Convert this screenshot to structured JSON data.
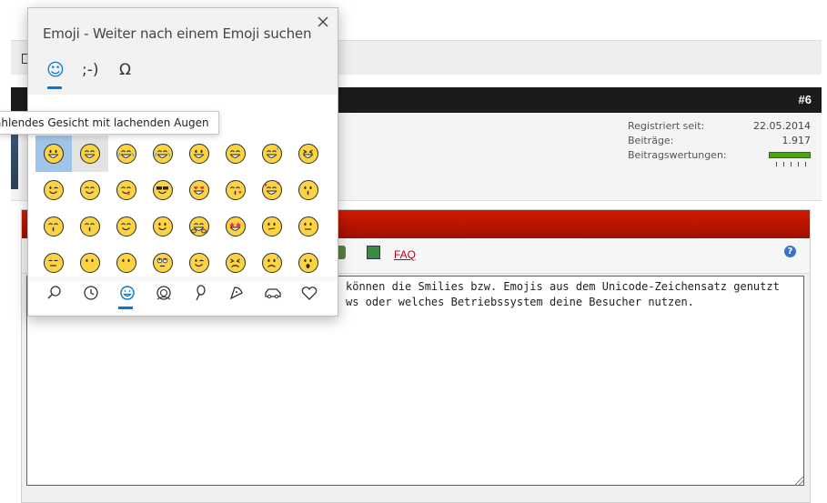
{
  "forum": {
    "post_number": "#6",
    "user_info": {
      "registered_label": "Registriert seit:",
      "registered_value": "22.05.2014",
      "posts_label": "Beiträge:",
      "posts_value": "1.917",
      "ratings_label": "Beitragswertungen:"
    },
    "toolbar": {
      "faq_label": "FAQ",
      "help_label": "?"
    },
    "textarea_line1": "können die Smilies bzw. Emojis aus dem Unicode-Zeichensatz genutzt",
    "textarea_line2": "ws oder welches Betriebssystem deine Besucher nutzen."
  },
  "emoji_panel": {
    "title": "Emoji - Weiter nach einem Emoji suchen",
    "close_icon": "close-icon",
    "tabs": [
      {
        "label": "☺",
        "name": "emoji-tab",
        "selected": true
      },
      {
        "label": ";-)",
        "name": "kaomoji-tab",
        "selected": false
      },
      {
        "label": "Ω",
        "name": "symbols-tab",
        "selected": false
      }
    ],
    "tooltip": "ahlendes Gesicht mit lachenden Augen",
    "emoji_grid": [
      [
        "grinning",
        "grimacing",
        "joy",
        "rofl",
        "smiley",
        "smile",
        "sweat-smile",
        "laughing"
      ],
      [
        "wink",
        "blush",
        "yum",
        "sunglasses",
        "heart-eyes",
        "kissing-heart",
        "smiling-hearts",
        "kissing"
      ],
      [
        "kissing-smiling-eyes",
        "kissing-closed-eyes",
        "relaxed",
        "slight-smile",
        "hugging",
        "star-struck",
        "thinking",
        "neutral"
      ],
      [
        "expressionless",
        "no-mouth",
        "face-without-mouth",
        "rolling-eyes",
        "smirk",
        "persevere",
        "disappointed-relieved",
        "open-mouth"
      ]
    ],
    "categories": [
      "search-icon",
      "recent-clock-icon",
      "smiley-faces-icon",
      "people-icon",
      "celebration-icon",
      "food-icon",
      "travel-car-icon",
      "heart-icon"
    ],
    "colors": {
      "accent": "#0078d4",
      "emoji_yellow": "#fcd443",
      "selected_cell": "#9fc4e8",
      "red_bar": "#c41400"
    }
  }
}
